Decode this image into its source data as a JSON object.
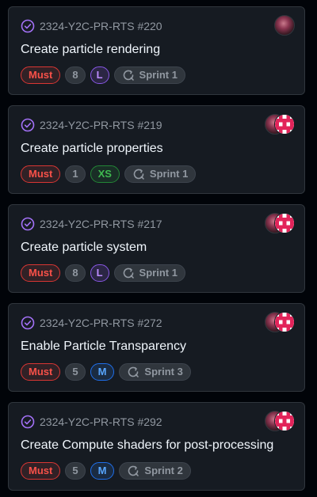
{
  "colors": {
    "background": "#010409",
    "card": "#161b22",
    "border": "#30363d",
    "status_purple": "#a371f7",
    "priority_red": "#f85149",
    "avatar_pink": "#e2245a"
  },
  "cards": [
    {
      "issue_ref": "2324-Y2C-PR-RTS #220",
      "title": "Create particle rendering",
      "priority": "Must",
      "estimate": "8",
      "size": "L",
      "sprint": "Sprint 1",
      "status_icon": "issue-closed-icon",
      "assignees": [
        "photo-avatar"
      ]
    },
    {
      "issue_ref": "2324-Y2C-PR-RTS #219",
      "title": "Create particle properties",
      "priority": "Must",
      "estimate": "1",
      "size": "XS",
      "sprint": "Sprint 1",
      "status_icon": "issue-closed-icon",
      "assignees": [
        "photo-avatar",
        "pixel-avatar"
      ]
    },
    {
      "issue_ref": "2324-Y2C-PR-RTS #217",
      "title": "Create particle system",
      "priority": "Must",
      "estimate": "8",
      "size": "L",
      "sprint": "Sprint 1",
      "status_icon": "issue-closed-icon",
      "assignees": [
        "photo-avatar",
        "pixel-avatar"
      ]
    },
    {
      "issue_ref": "2324-Y2C-PR-RTS #272",
      "title": "Enable Particle Transparency",
      "priority": "Must",
      "estimate": "5",
      "size": "M",
      "sprint": "Sprint 3",
      "status_icon": "issue-closed-icon",
      "assignees": [
        "photo-avatar",
        "pixel-avatar"
      ]
    },
    {
      "issue_ref": "2324-Y2C-PR-RTS #292",
      "title": "Create Compute shaders for post-processing",
      "priority": "Must",
      "estimate": "5",
      "size": "M",
      "sprint": "Sprint 2",
      "status_icon": "issue-closed-icon",
      "assignees": [
        "photo-avatar",
        "pixel-avatar"
      ]
    }
  ]
}
